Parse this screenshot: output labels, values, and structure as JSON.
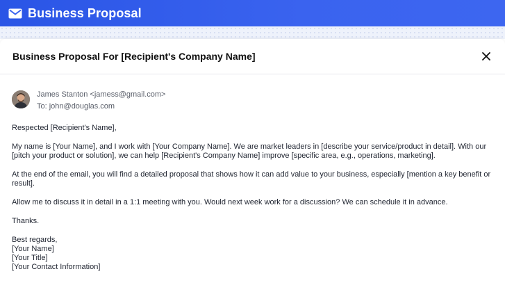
{
  "app": {
    "title": "Business Proposal",
    "icon": "mail-icon"
  },
  "email": {
    "subject": "Business Proposal For [Recipient's Company Name]",
    "from": "James Stanton <jamess@gmail.com>",
    "to": "To: john@douglas.com",
    "greeting": "Respected [Recipient's Name],",
    "paragraph1": "My name is [Your Name], and I work with [Your Company Name]. We are market leaders in [describe your service/product in detail]. With our [pitch your product or solution], we can help [Recipient's Company Name] improve [specific area, e.g., operations, marketing].",
    "paragraph2": "At the end of the email, you will find a detailed proposal that shows how it can add value to your business, especially [mention a key benefit or result].",
    "paragraph3": "Allow me to discuss it in detail in a 1:1 meeting with you. Would next week work for a discussion? We can schedule it in advance.",
    "thanks": "Thanks.",
    "signature": {
      "closing": "Best regards,",
      "name": "[Your Name]",
      "title": "[Your Title]",
      "contact": "[Your Contact Information]"
    }
  },
  "colors": {
    "accent": "#3a63ef",
    "text": "#1f2430",
    "muted": "#5a5f6a"
  }
}
